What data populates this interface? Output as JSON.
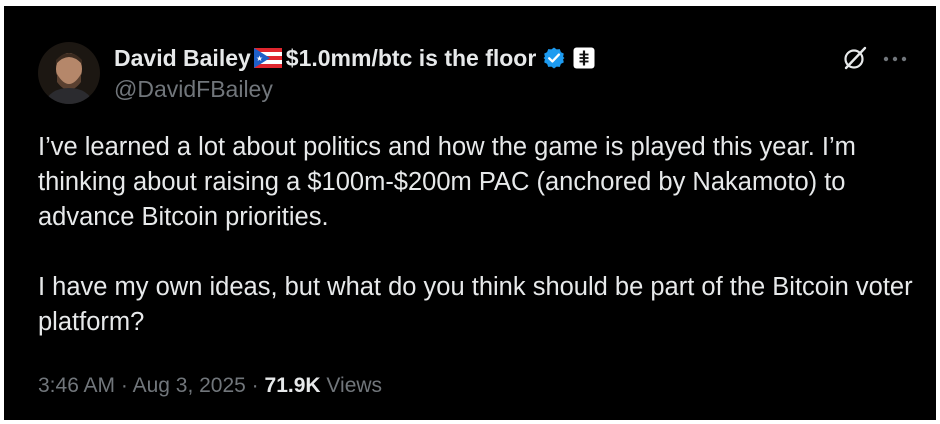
{
  "author": {
    "display_name": "David Bailey",
    "flag_icon": "puerto-rico-flag-icon",
    "name_suffix": "$1.0mm/btc is the floor",
    "handle": "@DavidFBailey",
    "verified_icon": "verified-badge-icon",
    "affiliate_icon": "affiliate-badge-icon"
  },
  "actions": {
    "grok_icon": "grok-icon",
    "more_icon": "more-options-icon"
  },
  "tweet": {
    "paragraphs": [
      "I’ve learned a lot about politics and how the game is played this year. I’m thinking about raising a $100m-$200m PAC (anchored by Nakamoto) to advance Bitcoin priorities.",
      "I have my own ideas, but what do you think should be part of the Bitcoin voter platform?"
    ]
  },
  "meta": {
    "time": "3:46 AM",
    "separator": " · ",
    "date": "Aug 3, 2025",
    "views_count": "71.9K",
    "views_label": " Views"
  },
  "colors": {
    "background": "#000000",
    "text_primary": "#e7e9ea",
    "text_secondary": "#71767b",
    "verified_blue": "#1d9bf0"
  }
}
